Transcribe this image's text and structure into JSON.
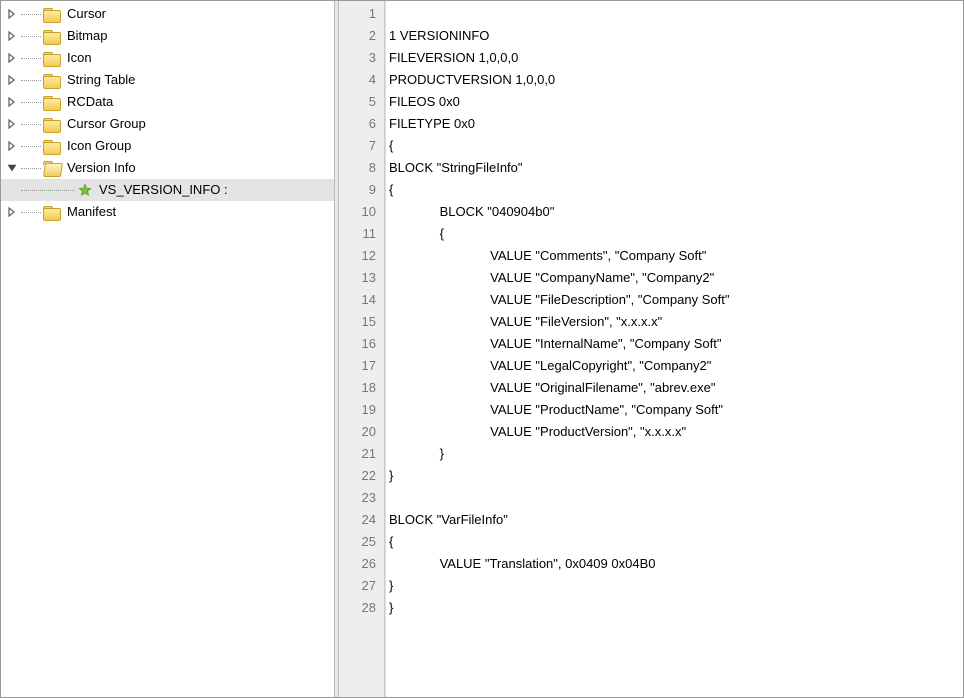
{
  "tree": {
    "items": [
      {
        "label": "Cursor",
        "expanded": false,
        "icon": "folder"
      },
      {
        "label": "Bitmap",
        "expanded": false,
        "icon": "folder"
      },
      {
        "label": "Icon",
        "expanded": false,
        "icon": "folder"
      },
      {
        "label": "String Table",
        "expanded": false,
        "icon": "folder"
      },
      {
        "label": "RCData",
        "expanded": false,
        "icon": "folder"
      },
      {
        "label": "Cursor Group",
        "expanded": false,
        "icon": "folder"
      },
      {
        "label": "Icon Group",
        "expanded": false,
        "icon": "folder"
      },
      {
        "label": "Version Info",
        "expanded": true,
        "icon": "folder-open",
        "children": [
          {
            "label": "VS_VERSION_INFO : ",
            "icon": "star",
            "selected": true
          }
        ]
      },
      {
        "label": "Manifest",
        "expanded": false,
        "icon": "folder"
      }
    ]
  },
  "code_lines": [
    "",
    "1 VERSIONINFO",
    "FILEVERSION 1,0,0,0",
    "PRODUCTVERSION 1,0,0,0",
    "FILEOS 0x0",
    "FILETYPE 0x0",
    "{",
    "BLOCK \"StringFileInfo\"",
    "{",
    "\tBLOCK \"040904b0\"",
    "\t{",
    "\t\tVALUE \"Comments\", \"Company Soft\"",
    "\t\tVALUE \"CompanyName\", \"Company2\"",
    "\t\tVALUE \"FileDescription\", \"Company Soft\"",
    "\t\tVALUE \"FileVersion\", \"x.x.x.x\"",
    "\t\tVALUE \"InternalName\", \"Company Soft\"",
    "\t\tVALUE \"LegalCopyright\", \"Company2\"",
    "\t\tVALUE \"OriginalFilename\", \"abrev.exe\"",
    "\t\tVALUE \"ProductName\", \"Company Soft\"",
    "\t\tVALUE \"ProductVersion\", \"x.x.x.x\"",
    "\t}",
    "}",
    "",
    "BLOCK \"VarFileInfo\"",
    "{",
    "\tVALUE \"Translation\", 0x0409 0x04B0",
    "}",
    "}"
  ]
}
